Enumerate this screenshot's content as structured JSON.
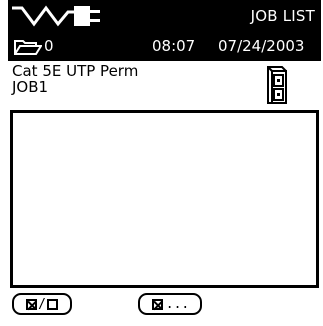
{
  "header": {
    "title": "JOB LIST",
    "folder_count": "0",
    "time": "08:07",
    "date": "07/24/2003"
  },
  "info": {
    "cable_type": "Cat 5E UTP Perm",
    "job_name": "JOB1"
  },
  "job_list": {
    "items": []
  },
  "softkeys": {
    "left_separator": "/",
    "right_suffix": "..."
  },
  "icons": {
    "cable": "cable-plug-icon",
    "folder": "folder-icon",
    "cabinet": "file-cabinet-icon",
    "select_all": "checkbox-toggle-icon",
    "more": "checkbox-more-icon"
  }
}
